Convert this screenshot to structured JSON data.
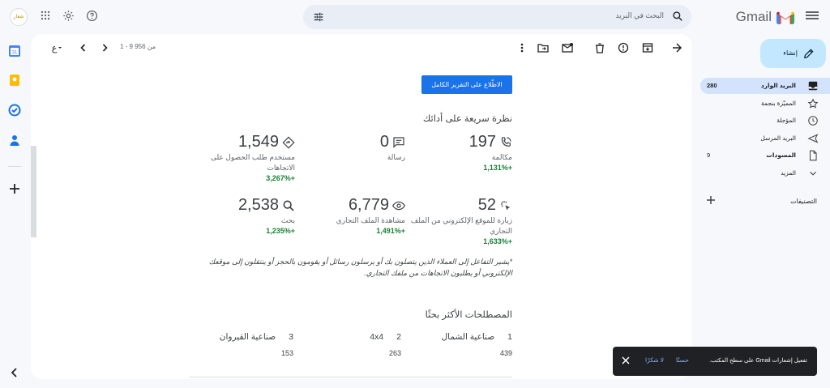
{
  "app": {
    "logo_text": "Gmail"
  },
  "search": {
    "placeholder": "البحث في البريد"
  },
  "account": {
    "avatar_text": "شعار"
  },
  "toolbar": {
    "pager": "1 - 9 من 956"
  },
  "report": {
    "view_full_report": "الاطّلاع على التقرير الكامل",
    "glance_title": "نظرة سريعة على أدائك",
    "stats": [
      {
        "value": "197",
        "label": "مكالمة",
        "change": "+1,131%",
        "icon": "phone-icon"
      },
      {
        "value": "0",
        "label": "رسالة",
        "change": "",
        "icon": "message-icon"
      },
      {
        "value": "1,549",
        "label": "مستخدم طلب الحصول على الاتجاهات",
        "change": "+3,267%",
        "icon": "directions-icon"
      },
      {
        "value": "52",
        "label": "زيارة للموقع الإلكتروني من الملف التجاري",
        "change": "+1,633%",
        "icon": "click-icon"
      },
      {
        "value": "6,779",
        "label": "مشاهدة الملف التجاري",
        "change": "+1,491%",
        "icon": "eye-icon"
      },
      {
        "value": "2,538",
        "label": "بحث",
        "change": "+1,235%",
        "icon": "search-icon"
      }
    ],
    "note": "*يشير التفاعل إلى العملاء الذين يتصلون بك أو يرسلون رسائل أو يقومون بالحجز أو ينتقلون إلى موقعك الإلكتروني أو يطلبون الاتجاهات من ملفك التجاري.",
    "terms_title": "المصطلحات الأكثر بحثًا",
    "terms": [
      {
        "index": "1",
        "term": "صناعية الشمال",
        "count": "439"
      },
      {
        "index": "2",
        "term": "4x4",
        "count": "263"
      },
      {
        "index": "3",
        "term": "صناعية القيروان",
        "count": "153"
      }
    ]
  },
  "sidebar": {
    "compose": "إنشاء",
    "items": [
      {
        "label": "البريد الوارد",
        "count": "280",
        "icon": "inbox-icon"
      },
      {
        "label": "المميّزة بنجمة",
        "count": "",
        "icon": "star-icon"
      },
      {
        "label": "المؤجلة",
        "count": "",
        "icon": "clock-icon"
      },
      {
        "label": "البريد المرسل",
        "count": "",
        "icon": "send-icon"
      },
      {
        "label": "المسودات",
        "count": "9",
        "icon": "draft-icon"
      },
      {
        "label": "المزيد",
        "count": "",
        "icon": "chevron-down-icon"
      }
    ],
    "labels_title": "التصنيفات"
  },
  "snackbar": {
    "message": "تفعيل إشعارات Gmail على سطح المكتب.",
    "ok": "حسنًا",
    "no_thanks": "لا شكرًا"
  },
  "colors": {
    "accent": "#1a73e8",
    "positive": "#188038",
    "compose_bg": "#c2e7ff",
    "active_nav": "#d3e3fd"
  }
}
